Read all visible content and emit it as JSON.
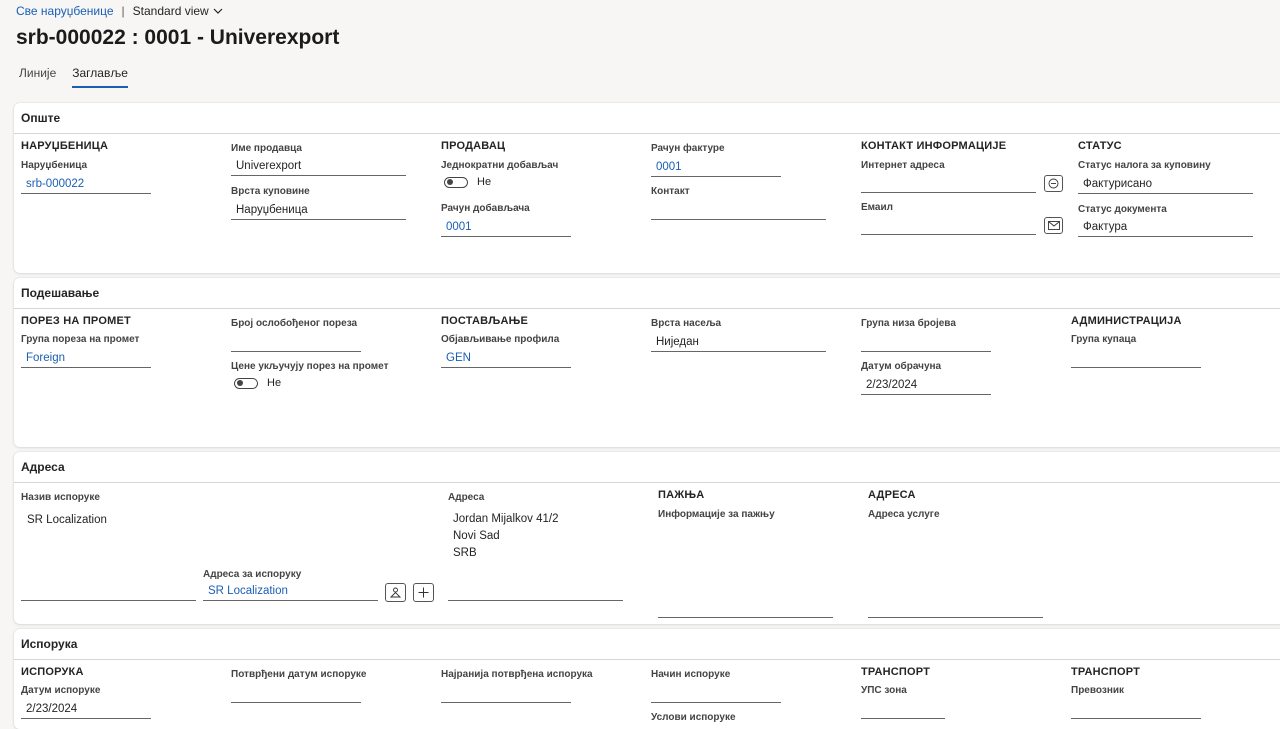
{
  "breadcrumb": {
    "all_orders": "Све наруџбенице",
    "separator": "|",
    "view": "Standard view"
  },
  "page_title": "srb-000022 : 0001 - Univerexport",
  "tabs": [
    {
      "label": "Линије",
      "active": false
    },
    {
      "label": "Заглавље",
      "active": true
    }
  ],
  "general": {
    "header": "Опште",
    "po_group": "НАРУЏБЕНИЦА",
    "po_label": "Наруџбеница",
    "po_value": "srb-000022",
    "vendor_name_label": "Име продавца",
    "vendor_name_value": "Univerexport",
    "po_type_label": "Врста куповине",
    "po_type_value": "Наруџбеница",
    "vendor_group": "ПРОДАВАЦ",
    "onetime_label": "Једнократни добављач",
    "onetime_value": "Не",
    "vendor_account_label": "Рачун добављача",
    "vendor_account_value": "0001",
    "invoice_account_label": "Рачун фактуре",
    "invoice_account_value": "0001",
    "contact_label": "Контакт",
    "contact_group": "КОНТАКТ ИНФОРМАЦИЈЕ",
    "internet_label": "Интернет адреса",
    "email_label": "Емаил",
    "status_group": "СТАТУС",
    "po_status_label": "Статус налога за куповину",
    "po_status_value": "Фактурисано",
    "doc_status_label": "Статус документа",
    "doc_status_value": "Фактура"
  },
  "setup": {
    "header": "Подешавање",
    "tax_group": "ПОРЕЗ НА ПРОМЕТ",
    "tax_group_label": "Група пореза на промет",
    "tax_group_value": "Foreign",
    "tax_exempt_label": "Број ослобођеног пореза",
    "prices_incl_label": "Цене укључују порез на промет",
    "prices_incl_value": "Не",
    "posting_group": "ПОСТАВЉАЊЕ",
    "posting_profile_label": "Објављивање профила",
    "posting_profile_value": "GEN",
    "settlement_label": "Врста насеља",
    "settlement_value": "Ниједан",
    "number_seq_label": "Група низа бројева",
    "calc_date_label": "Датум обрачуна",
    "calc_date_value": "2/23/2024",
    "admin_group": "АДМИНИСТРАЦИЈА",
    "buyer_group_label": "Група купаца"
  },
  "address": {
    "header": "Адреса",
    "delivery_name_label": "Назив испоруке",
    "delivery_name_value": "SR Localization",
    "delivery_address_label": "Адреса за испоруку",
    "delivery_address_value": "SR Localization",
    "address_label": "Адреса",
    "address_lines": [
      "Jordan Mijalkov 41/2",
      "Novi Sad",
      "SRB"
    ],
    "attention_group": "ПАЖЊА",
    "attention_label": "Информације за пажњу",
    "service_group": "АДРЕСА",
    "service_label": "Адреса услуге"
  },
  "delivery": {
    "header": "Испорука",
    "delivery_group": "ИСПОРУКА",
    "delivery_date_label": "Датум испоруке",
    "delivery_date_value": "2/23/2024",
    "confirmed_date_label": "Потврђени датум испоруке",
    "earliest_confirmed_label": "Најранија потврђена испорука",
    "mode_label": "Начин испоруке",
    "terms_label": "Услови испоруке",
    "transport_group_1": "ТРАНСПОРТ",
    "ups_zone_label": "УПС зона",
    "transport_group_2": "ТРАНСПОРТ",
    "carrier_label": "Превозник"
  }
}
